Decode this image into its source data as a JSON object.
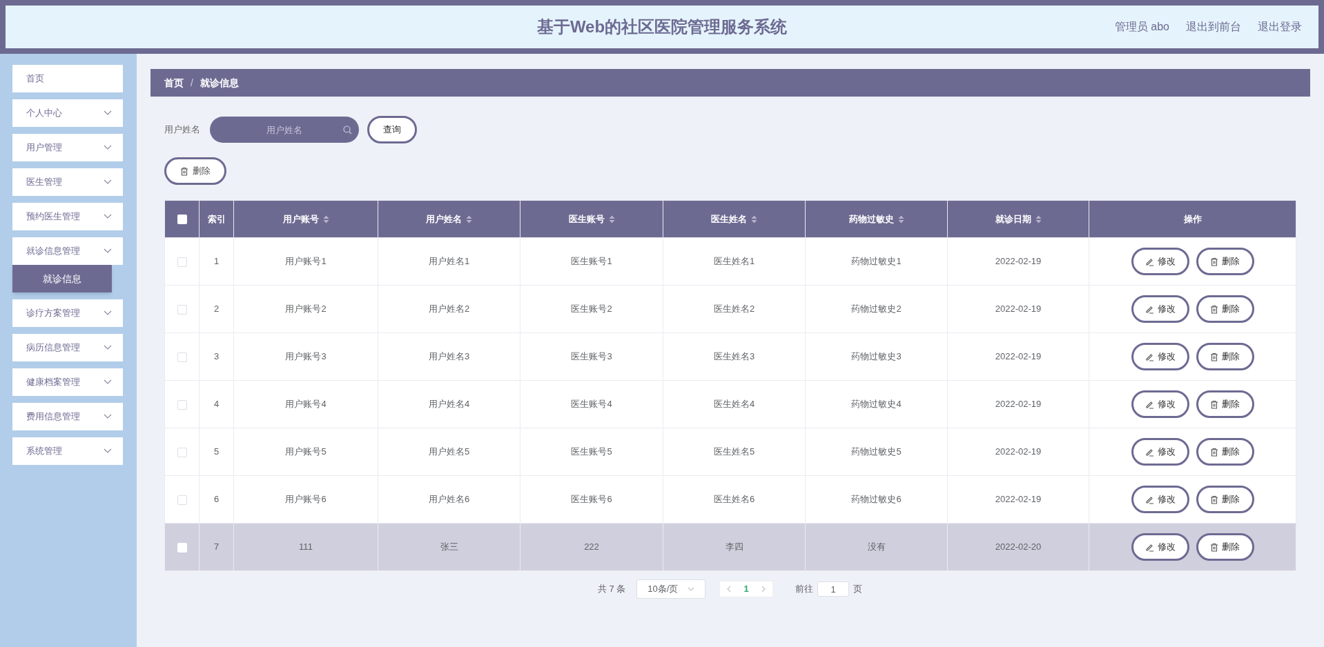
{
  "header": {
    "title": "基于Web的社区医院管理服务系统",
    "user": "管理员 abo",
    "links": [
      "退出到前台",
      "退出登录"
    ]
  },
  "sidebar": {
    "items": [
      {
        "label": "首页",
        "kind": "link"
      },
      {
        "label": "个人中心",
        "kind": "menu"
      },
      {
        "label": "用户管理",
        "kind": "menu"
      },
      {
        "label": "医生管理",
        "kind": "menu"
      },
      {
        "label": "预约医生管理",
        "kind": "menu"
      },
      {
        "label": "就诊信息管理",
        "kind": "menu",
        "children": [
          {
            "label": "就诊信息",
            "selected": true
          }
        ]
      },
      {
        "label": "诊疗方案管理",
        "kind": "menu"
      },
      {
        "label": "病历信息管理",
        "kind": "menu"
      },
      {
        "label": "健康档案管理",
        "kind": "menu"
      },
      {
        "label": "费用信息管理",
        "kind": "menu"
      },
      {
        "label": "系统管理",
        "kind": "menu"
      }
    ]
  },
  "breadcrumb": [
    "首页",
    "/",
    "就诊信息"
  ],
  "search": {
    "label": "用户姓名",
    "placeholder": "用户姓名",
    "button": "查询"
  },
  "delete_button": "删除",
  "table": {
    "all_checked": false,
    "columns": [
      {
        "label": "索引",
        "sortable": false
      },
      {
        "label": "用户账号",
        "sortable": true
      },
      {
        "label": "用户姓名",
        "sortable": true
      },
      {
        "label": "医生账号",
        "sortable": true
      },
      {
        "label": "医生姓名",
        "sortable": true
      },
      {
        "label": "药物过敏史",
        "sortable": true
      },
      {
        "label": "就诊日期",
        "sortable": true
      },
      {
        "label": "操作",
        "sortable": false
      }
    ],
    "rows": [
      {
        "cells": [
          "1",
          "用户账号1",
          "用户姓名1",
          "医生账号1",
          "医生姓名1",
          "药物过敏史1",
          "2022-02-19"
        ],
        "checked": false,
        "highlighted": false,
        "actions": [
          "修改",
          "删除"
        ]
      },
      {
        "cells": [
          "2",
          "用户账号2",
          "用户姓名2",
          "医生账号2",
          "医生姓名2",
          "药物过敏史2",
          "2022-02-19"
        ],
        "checked": false,
        "highlighted": false,
        "actions": [
          "修改",
          "删除"
        ]
      },
      {
        "cells": [
          "3",
          "用户账号3",
          "用户姓名3",
          "医生账号3",
          "医生姓名3",
          "药物过敏史3",
          "2022-02-19"
        ],
        "checked": false,
        "highlighted": false,
        "actions": [
          "修改",
          "删除"
        ]
      },
      {
        "cells": [
          "4",
          "用户账号4",
          "用户姓名4",
          "医生账号4",
          "医生姓名4",
          "药物过敏史4",
          "2022-02-19"
        ],
        "checked": false,
        "highlighted": false,
        "actions": [
          "修改",
          "删除"
        ]
      },
      {
        "cells": [
          "5",
          "用户账号5",
          "用户姓名5",
          "医生账号5",
          "医生姓名5",
          "药物过敏史5",
          "2022-02-19"
        ],
        "checked": false,
        "highlighted": false,
        "actions": [
          "修改",
          "删除"
        ]
      },
      {
        "cells": [
          "6",
          "用户账号6",
          "用户姓名6",
          "医生账号6",
          "医生姓名6",
          "药物过敏史6",
          "2022-02-19"
        ],
        "checked": false,
        "highlighted": false,
        "actions": [
          "修改",
          "删除"
        ]
      },
      {
        "cells": [
          "7",
          "111",
          "张三",
          "222",
          "李四",
          "没有",
          "2022-02-20"
        ],
        "checked": false,
        "highlighted": true,
        "actions": [
          "修改",
          "删除"
        ]
      }
    ]
  },
  "pagination": {
    "total": "共 7 条",
    "page_size": "10条/页",
    "pages": [
      {
        "label": "1",
        "selected": true
      }
    ],
    "goto_label": "前往",
    "goto_value": "1",
    "goto_suffix": "页"
  }
}
